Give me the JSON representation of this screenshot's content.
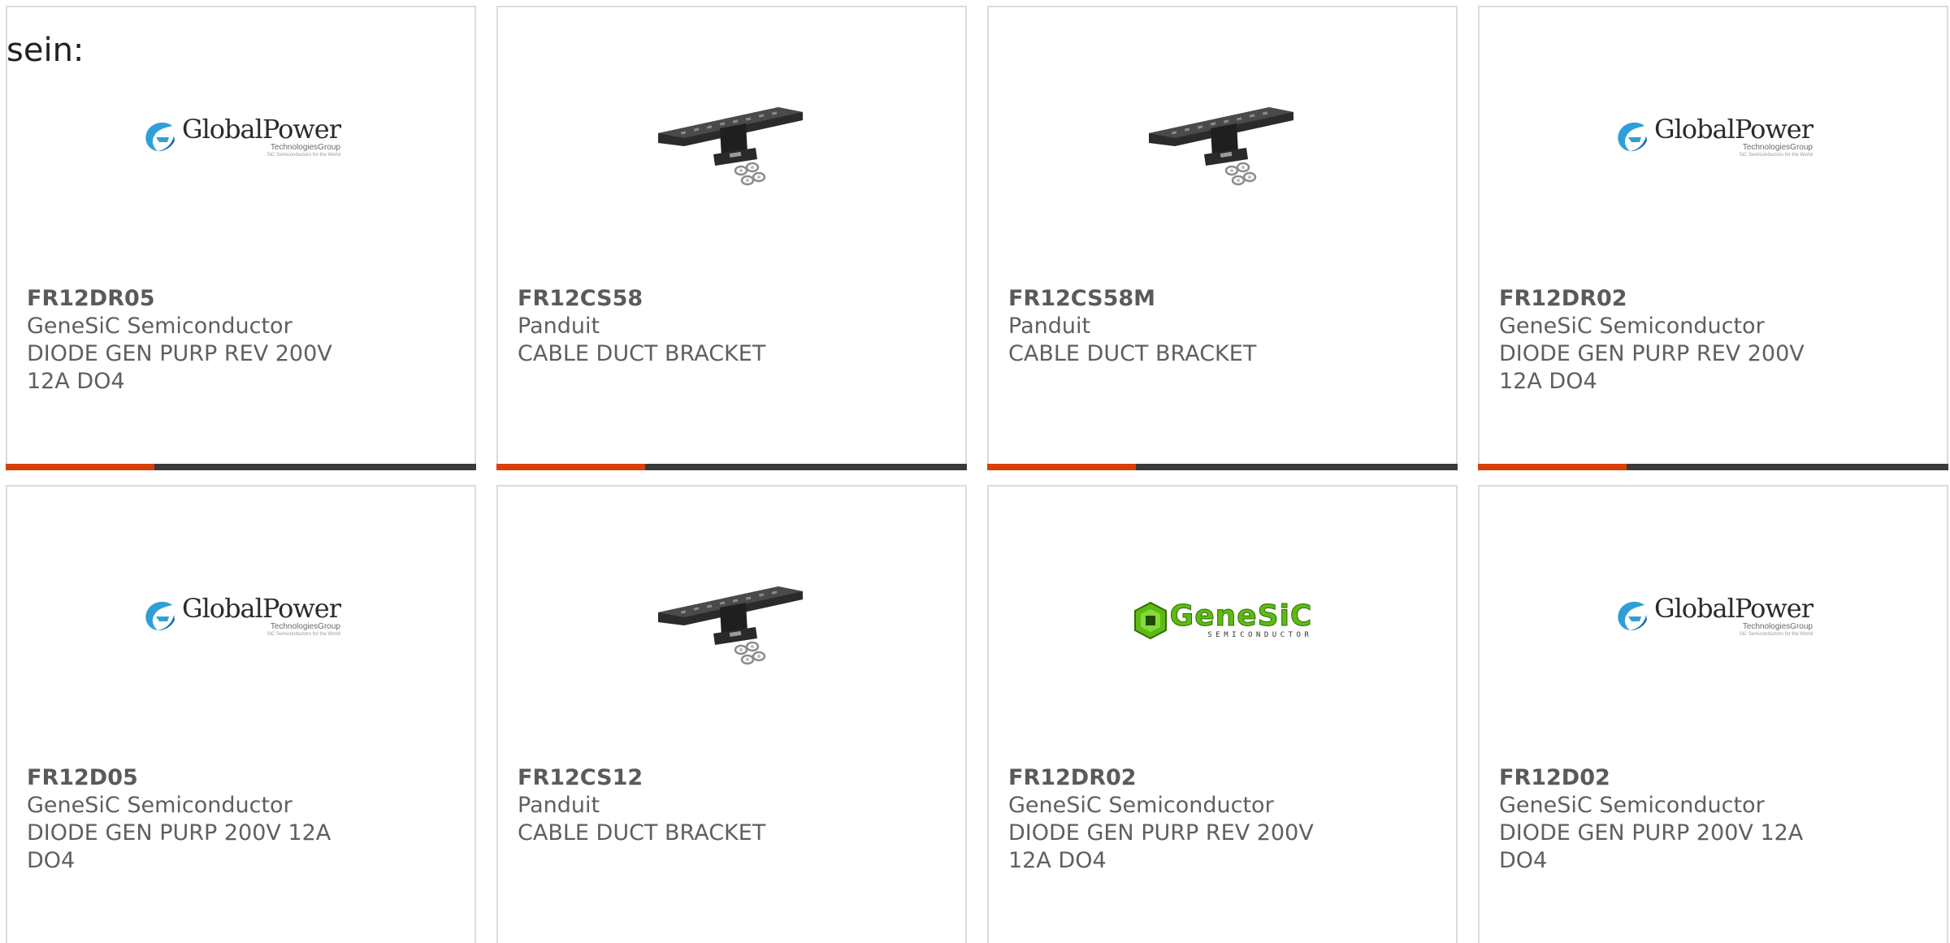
{
  "intro_text": "sein:",
  "colors": {
    "accent": "#d8400a",
    "bar_dark": "#3a3a3a",
    "border": "#dcdcdc",
    "text": "#5f5f5f"
  },
  "logos": {
    "globalpower": {
      "name": "GlobalPower",
      "sub": "TechnologiesGroup",
      "tagline": "SiC Semiconductors for the World"
    },
    "genesic": {
      "name": "GeneSiC",
      "sub": "SEMICONDUCTOR"
    }
  },
  "products": [
    {
      "part_number": "FR12DR05",
      "manufacturer": "GeneSiC Semiconductor",
      "description": "DIODE GEN PURP REV 200V 12A DO4",
      "image": "globalpower-logo"
    },
    {
      "part_number": "FR12CS58",
      "manufacturer": "Panduit",
      "description": "CABLE DUCT BRACKET",
      "image": "cable-duct-bracket-photo"
    },
    {
      "part_number": "FR12CS58M",
      "manufacturer": "Panduit",
      "description": "CABLE DUCT BRACKET",
      "image": "cable-duct-bracket-photo"
    },
    {
      "part_number": "FR12DR02",
      "manufacturer": "GeneSiC Semiconductor",
      "description": "DIODE GEN PURP REV 200V 12A DO4",
      "image": "globalpower-logo"
    },
    {
      "part_number": "FR12D05",
      "manufacturer": "GeneSiC Semiconductor",
      "description": "DIODE GEN PURP 200V 12A DO4",
      "image": "globalpower-logo"
    },
    {
      "part_number": "FR12CS12",
      "manufacturer": "Panduit",
      "description": "CABLE DUCT BRACKET",
      "image": "cable-duct-bracket-photo"
    },
    {
      "part_number": "FR12DR02",
      "manufacturer": "GeneSiC Semiconductor",
      "description": "DIODE GEN PURP REV 200V 12A DO4",
      "image": "genesic-logo"
    },
    {
      "part_number": "FR12D02",
      "manufacturer": "GeneSiC Semiconductor",
      "description": "DIODE GEN PURP 200V 12A DO4",
      "image": "globalpower-logo"
    }
  ]
}
